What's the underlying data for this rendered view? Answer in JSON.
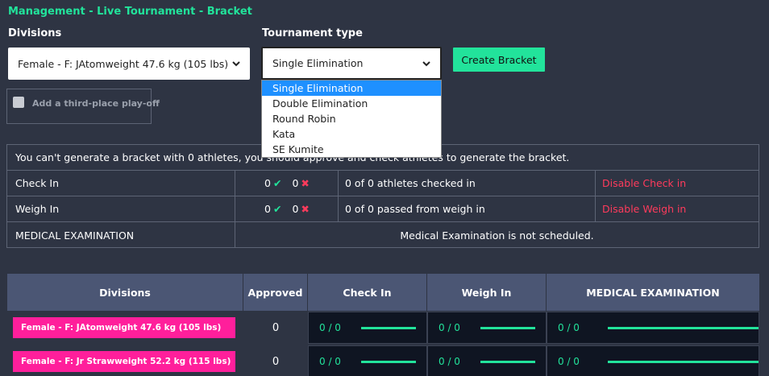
{
  "breadcrumb": "Management  -  Live Tournament  -  Bracket",
  "divisions_label": "Divisions",
  "tournament_type_label": "Tournament type",
  "division_select": {
    "value": "Female - F: JAtomweight 47.6 kg (105 lbs)"
  },
  "type_select": {
    "value": "Single Elimination",
    "options": [
      "Single Elimination",
      "Double Elimination",
      "Round Robin",
      "Kata",
      "SE Kumite"
    ]
  },
  "create_button": "Create Bracket",
  "third_place": "Add a third-place play-off",
  "info": {
    "message": "You can't generate a bracket with 0 athletes, you should approve and check athletes to generate the bracket.",
    "checkin": {
      "label": "Check In",
      "ok": "0",
      "fail": "0",
      "summary": "0 of 0 athletes checked in",
      "action": "Disable Check in"
    },
    "weighin": {
      "label": "Weigh In",
      "ok": "0",
      "fail": "0",
      "summary": "0 of 0 passed from weigh in",
      "action": "Disable Weigh in"
    },
    "medical": {
      "label": "MEDICAL EXAMINATION",
      "summary": "Medical Examination is not scheduled."
    }
  },
  "table": {
    "headers": [
      "Divisions",
      "Approved",
      "Check In",
      "Weigh In",
      "MEDICAL EXAMINATION"
    ],
    "rows": [
      {
        "division": "Female - F: JAtomweight 47.6 kg (105 lbs)",
        "approved": "0",
        "checkin": "0 / 0",
        "weighin": "0 / 0",
        "medical": "0 / 0"
      },
      {
        "division": "Female - F: Jr Strawweight 52.2 kg (115 lbs)",
        "approved": "0",
        "checkin": "0 / 0",
        "weighin": "0 / 0",
        "medical": "0 / 0"
      }
    ]
  },
  "colors": {
    "accent": "#22e39b",
    "danger": "#ff3b5c",
    "division_tag": "#ff1f9b",
    "header": "#4b5674"
  }
}
